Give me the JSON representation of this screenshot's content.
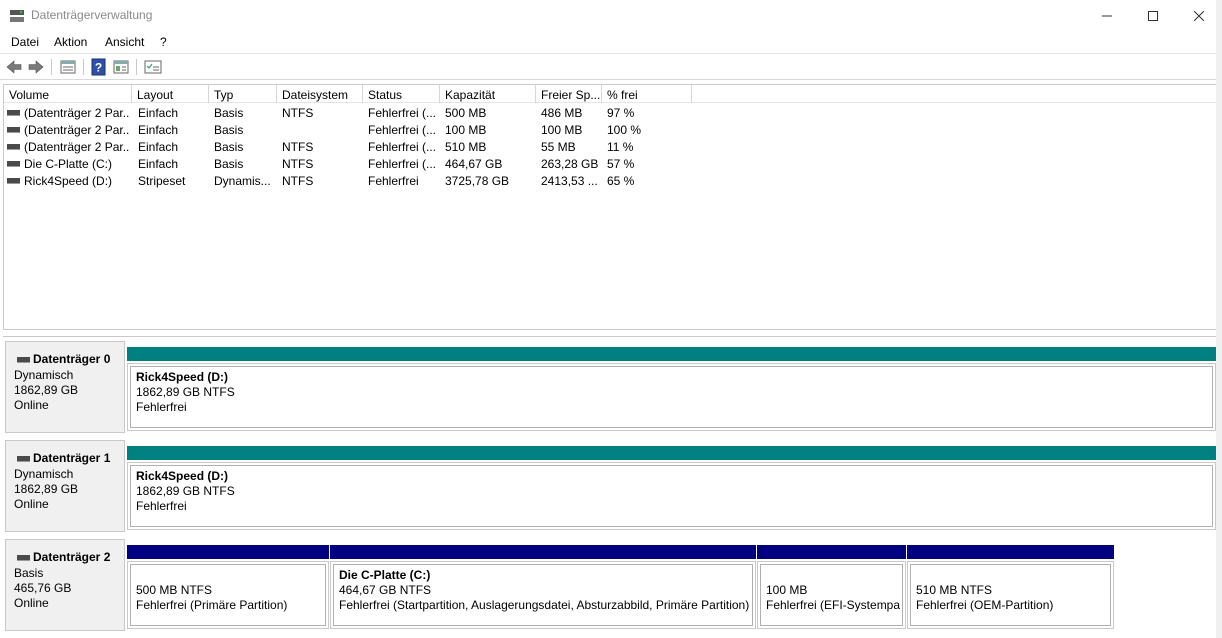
{
  "window": {
    "title": "Datenträgerverwaltung"
  },
  "menu": [
    "Datei",
    "Aktion",
    "Ansicht",
    "?"
  ],
  "toolbar": {
    "icons": [
      "back-arrow-icon",
      "forward-arrow-icon",
      "list-view-icon",
      "help-icon",
      "properties-icon",
      "checklist-icon"
    ]
  },
  "columns": [
    "Volume",
    "Layout",
    "Typ",
    "Dateisystem",
    "Status",
    "Kapazität",
    "Freier Sp...",
    "% frei"
  ],
  "volumes": [
    {
      "volume": "(Datenträger 2 Par...",
      "layout": "Einfach",
      "typ": "Basis",
      "dateisystem": "NTFS",
      "status": "Fehlerfrei (...",
      "kapazitaet": "500 MB",
      "frei": "486 MB",
      "prozent": "97 %"
    },
    {
      "volume": "(Datenträger 2 Par...",
      "layout": "Einfach",
      "typ": "Basis",
      "dateisystem": "",
      "status": "Fehlerfrei (...",
      "kapazitaet": "100 MB",
      "frei": "100 MB",
      "prozent": "100 %"
    },
    {
      "volume": "(Datenträger 2 Par...",
      "layout": "Einfach",
      "typ": "Basis",
      "dateisystem": "NTFS",
      "status": "Fehlerfrei (...",
      "kapazitaet": "510 MB",
      "frei": "55 MB",
      "prozent": "11 %"
    },
    {
      "volume": "Die C-Platte (C:)",
      "layout": "Einfach",
      "typ": "Basis",
      "dateisystem": "NTFS",
      "status": "Fehlerfrei (...",
      "kapazitaet": "464,67 GB",
      "frei": "263,28 GB",
      "prozent": "57 %"
    },
    {
      "volume": "Rick4Speed (D:)",
      "layout": "Stripeset",
      "typ": "Dynamis...",
      "dateisystem": "NTFS",
      "status": "Fehlerfrei",
      "kapazitaet": "3725,78 GB",
      "frei": "2413,53 ...",
      "prozent": "65 %"
    }
  ],
  "disks": [
    {
      "name": "Datenträger 0",
      "type": "Dynamisch",
      "size": "1862,89 GB",
      "state": "Online",
      "partitions": [
        {
          "title": "Rick4Speed  (D:)",
          "line1": "1862,89 GB NTFS",
          "line2": "Fehlerfrei",
          "color": "#008080"
        }
      ]
    },
    {
      "name": "Datenträger 1",
      "type": "Dynamisch",
      "size": "1862,89 GB",
      "state": "Online",
      "partitions": [
        {
          "title": "Rick4Speed  (D:)",
          "line1": "1862,89 GB NTFS",
          "line2": "Fehlerfrei",
          "color": "#008080"
        }
      ]
    },
    {
      "name": "Datenträger 2",
      "type": "Basis",
      "size": "465,76 GB",
      "state": "Online",
      "partitions": [
        {
          "title": "",
          "line1": "500 MB NTFS",
          "line2": "Fehlerfrei (Primäre Partition)",
          "color": "#000080"
        },
        {
          "title": "Die C-Platte  (C:)",
          "line1": "464,67 GB NTFS",
          "line2": "Fehlerfrei (Startpartition, Auslagerungsdatei, Absturzabbild, Primäre Partition)",
          "color": "#000080"
        },
        {
          "title": "",
          "line1": "100 MB",
          "line2": "Fehlerfrei (EFI-Systempart",
          "color": "#000080"
        },
        {
          "title": "",
          "line1": "510 MB NTFS",
          "line2": "Fehlerfrei (OEM-Partition)",
          "color": "#000080"
        }
      ]
    }
  ],
  "colors": {
    "dynamic_volume": "#008080",
    "primary_partition": "#000080",
    "panel_bg": "#f0f0f0"
  }
}
